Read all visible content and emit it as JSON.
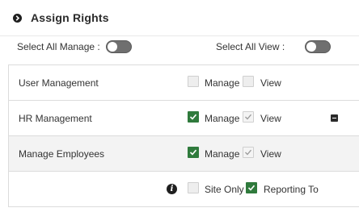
{
  "header": {
    "title": "Assign Rights",
    "icon": "chevron-circle-right-icon"
  },
  "select_all": {
    "manage_label": "Select All Manage :",
    "view_label": "Select All View :",
    "manage_on": false,
    "view_on": false
  },
  "rows": [
    {
      "name": "User Management",
      "manage_label": "Manage",
      "view_label": "View",
      "manage": false,
      "view": false
    },
    {
      "name": "HR Management",
      "manage_label": "Manage",
      "view_label": "View",
      "manage": true,
      "view": true,
      "view_disabled": true
    },
    {
      "name": "Manage Employees",
      "manage_label": "Manage",
      "view_label": "View",
      "manage": true,
      "view": true,
      "view_disabled": true
    }
  ],
  "scope_row": {
    "site_only_label": "Site Only",
    "reporting_to_label": "Reporting To",
    "site_only": false,
    "reporting_to": true,
    "info_icon": "info-icon"
  },
  "colors": {
    "accent_green": "#2f7a3c",
    "toggle_off": "#6f6f6f"
  }
}
